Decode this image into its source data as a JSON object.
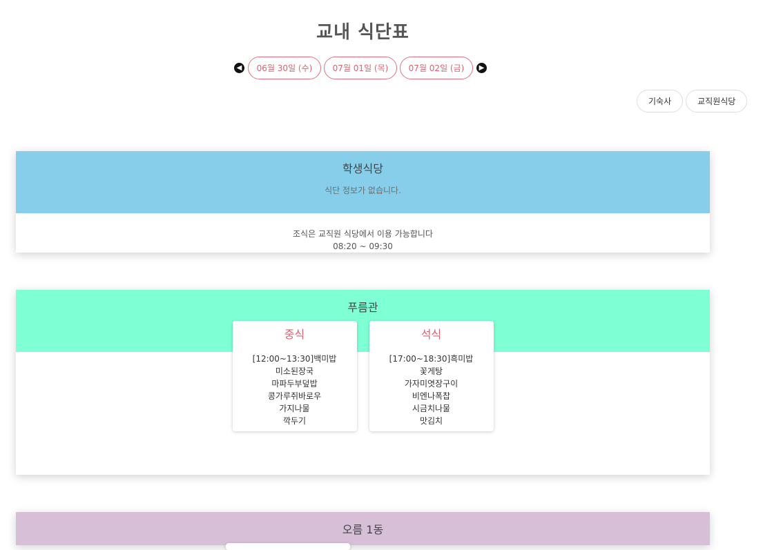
{
  "header": {
    "title": "교내 식단표"
  },
  "date_nav": {
    "prev_icon": "arrow-left-circle-icon",
    "next_icon": "arrow-right-circle-icon",
    "dates": [
      "06월 30일 (수)",
      "07월 01일 (목)",
      "07월 02일 (금)"
    ]
  },
  "dorm_buttons": [
    "기숙사",
    "교직원식당"
  ],
  "cafeterias": [
    {
      "name": "학생식당",
      "color": "#87ceeb",
      "empty_text": "식단 정보가 없습니다.",
      "note_lines": [
        "조식은 교직원 식당에서 이용 가능합니다",
        "08:20 ~ 09:30"
      ]
    },
    {
      "name": "푸름관",
      "color": "#7fffd4",
      "meals": [
        {
          "title": "중식",
          "items": [
            "[12:00~13:30]백미밥",
            "미소된장국",
            "마파두부덮밥",
            "콩가루쥐바로우",
            "가지나물",
            "깍두기"
          ]
        },
        {
          "title": "석식",
          "items": [
            "[17:00~18:30]흑미밥",
            "꽃게탕",
            "가자미엿장구이",
            "비엔나폭찹",
            "시금치나물",
            "맛김치"
          ]
        }
      ]
    },
    {
      "name": "오름 1동",
      "color": "#d8bfd8"
    }
  ]
}
